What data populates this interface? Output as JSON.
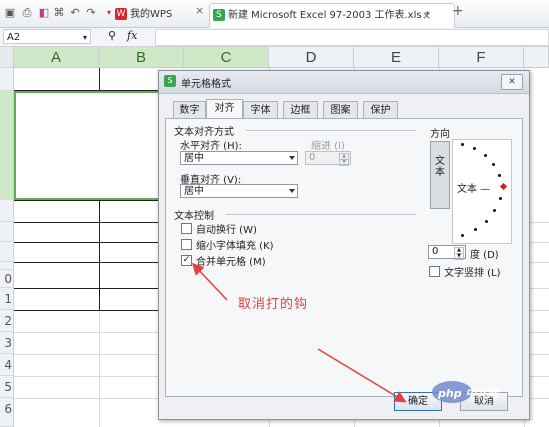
{
  "tabs": [
    {
      "label": "我的WPS",
      "icon": "wps-icon"
    },
    {
      "label": "新建 Microsoft Excel 97-2003 工作表.xls *",
      "icon": "spreadsheet-icon"
    }
  ],
  "tab_close": "×",
  "new_tab": "+",
  "formula_bar": {
    "cell_ref": "A2",
    "fx": "fx"
  },
  "columns": [
    "A",
    "B",
    "C",
    "D",
    "E",
    "F"
  ],
  "rows": [
    "",
    "",
    "",
    "",
    "",
    "",
    "",
    "",
    "",
    "0",
    "1",
    "2",
    "3",
    "4",
    "5",
    "6"
  ],
  "dialog": {
    "title": "单元格格式",
    "close": "✕",
    "tabs": [
      "数字",
      "对齐",
      "字体",
      "边框",
      "图案",
      "保护"
    ],
    "active_tab": "对齐",
    "text_alignment": {
      "section": "文本对齐方式",
      "horizontal_label": "水平对齐 (H):",
      "horizontal_value": "居中",
      "indent_label": "缩进 (I)",
      "indent_value": "0",
      "vertical_label": "垂直对齐 (V):",
      "vertical_value": "居中"
    },
    "text_control": {
      "section": "文本控制",
      "wrap": {
        "label": "自动换行 (W)",
        "checked": false
      },
      "shrink": {
        "label": "缩小字体填充 (K)",
        "checked": false
      },
      "merge": {
        "label": "合并单元格 (M)",
        "checked": true
      }
    },
    "orientation": {
      "section": "方向",
      "vertical_text": "文本",
      "preview_text": "文本 —",
      "degrees_value": "0",
      "degrees_label": "度 (D)",
      "vertical_stack_label": "文字竖排 (L)"
    },
    "ok": "确定",
    "cancel": "取消"
  },
  "annotation": "取消打的钩",
  "watermark": "php 中文网",
  "colors": {
    "accent_red": "#e2413f",
    "selection_green": "#5fae55"
  }
}
